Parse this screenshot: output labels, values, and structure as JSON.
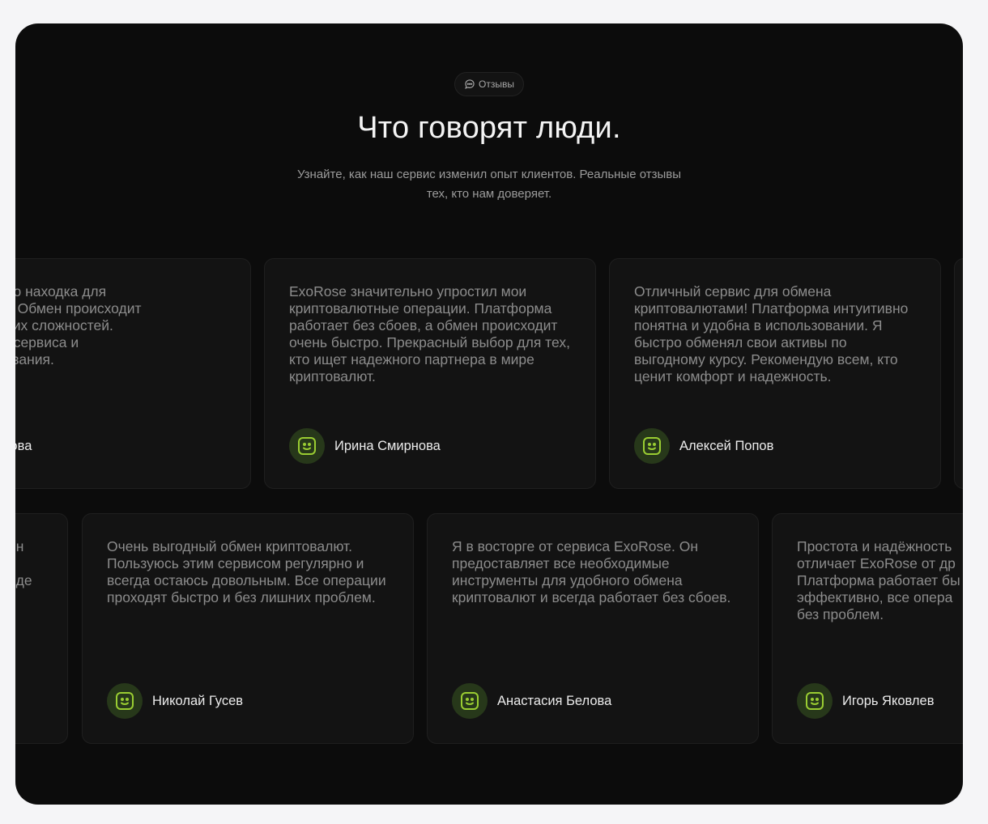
{
  "header": {
    "badge_label": "Отзывы",
    "title": "Что говорят люди.",
    "subtitle": "Узнайте, как наш сервис изменил опыт клиентов. Реальные отзывы тех, кто нам доверяет."
  },
  "row1": [
    {
      "text": "это просто находка для\nузиастов! Обмен происходит\nбез лишних сложностей.\nкачество сервиса и\nиспользования.",
      "name": "ия Фёдорова"
    },
    {
      "text": "ExoRose значительно упростил мои криптовалютные операции. Платформа работает без сбоев, а обмен происходит очень быстро. Прекрасный выбор для тех, кто ищет надежного партнера в мире криптовалют.",
      "name": "Ирина Смирнова"
    },
    {
      "text": "Отличный сервис для обмена криптовалютами! Платформа интуитивно понятна и удобна в использовании. Я быстро обменял свои активы по выгодному курсу. Рекомендую всем, кто ценит комфорт и надежность.",
      "name": "Алексей Попов"
    }
  ],
  "row2": [
    {
      "text": "ен\n\nнде",
      "name": ""
    },
    {
      "text": "Очень выгодный обмен криптовалют. Пользуюсь этим сервисом регулярно и всегда остаюсь довольным. Все операции проходят быстро и без лишних проблем.",
      "name": "Николай Гусев"
    },
    {
      "text": "Я в восторге от сервиса ExoRose. Он предоставляет все необходимые инструменты для удобного обмена криптовалют и всегда работает без сбоев.",
      "name": "Анастасия Белова"
    },
    {
      "text": "Простота и надёжность\nотличает ExoRose от др\nПлатформа работает бы\nэффективно, все опера\nбез проблем.",
      "name": "Игорь Яковлев"
    }
  ],
  "icons": {
    "badge": "chat-bubble-icon",
    "avatar": "smiley-face-icon"
  },
  "colors": {
    "accent": "#9acd32",
    "avatar_bg": "#27381a",
    "panel_bg": "#0c0c0c"
  }
}
